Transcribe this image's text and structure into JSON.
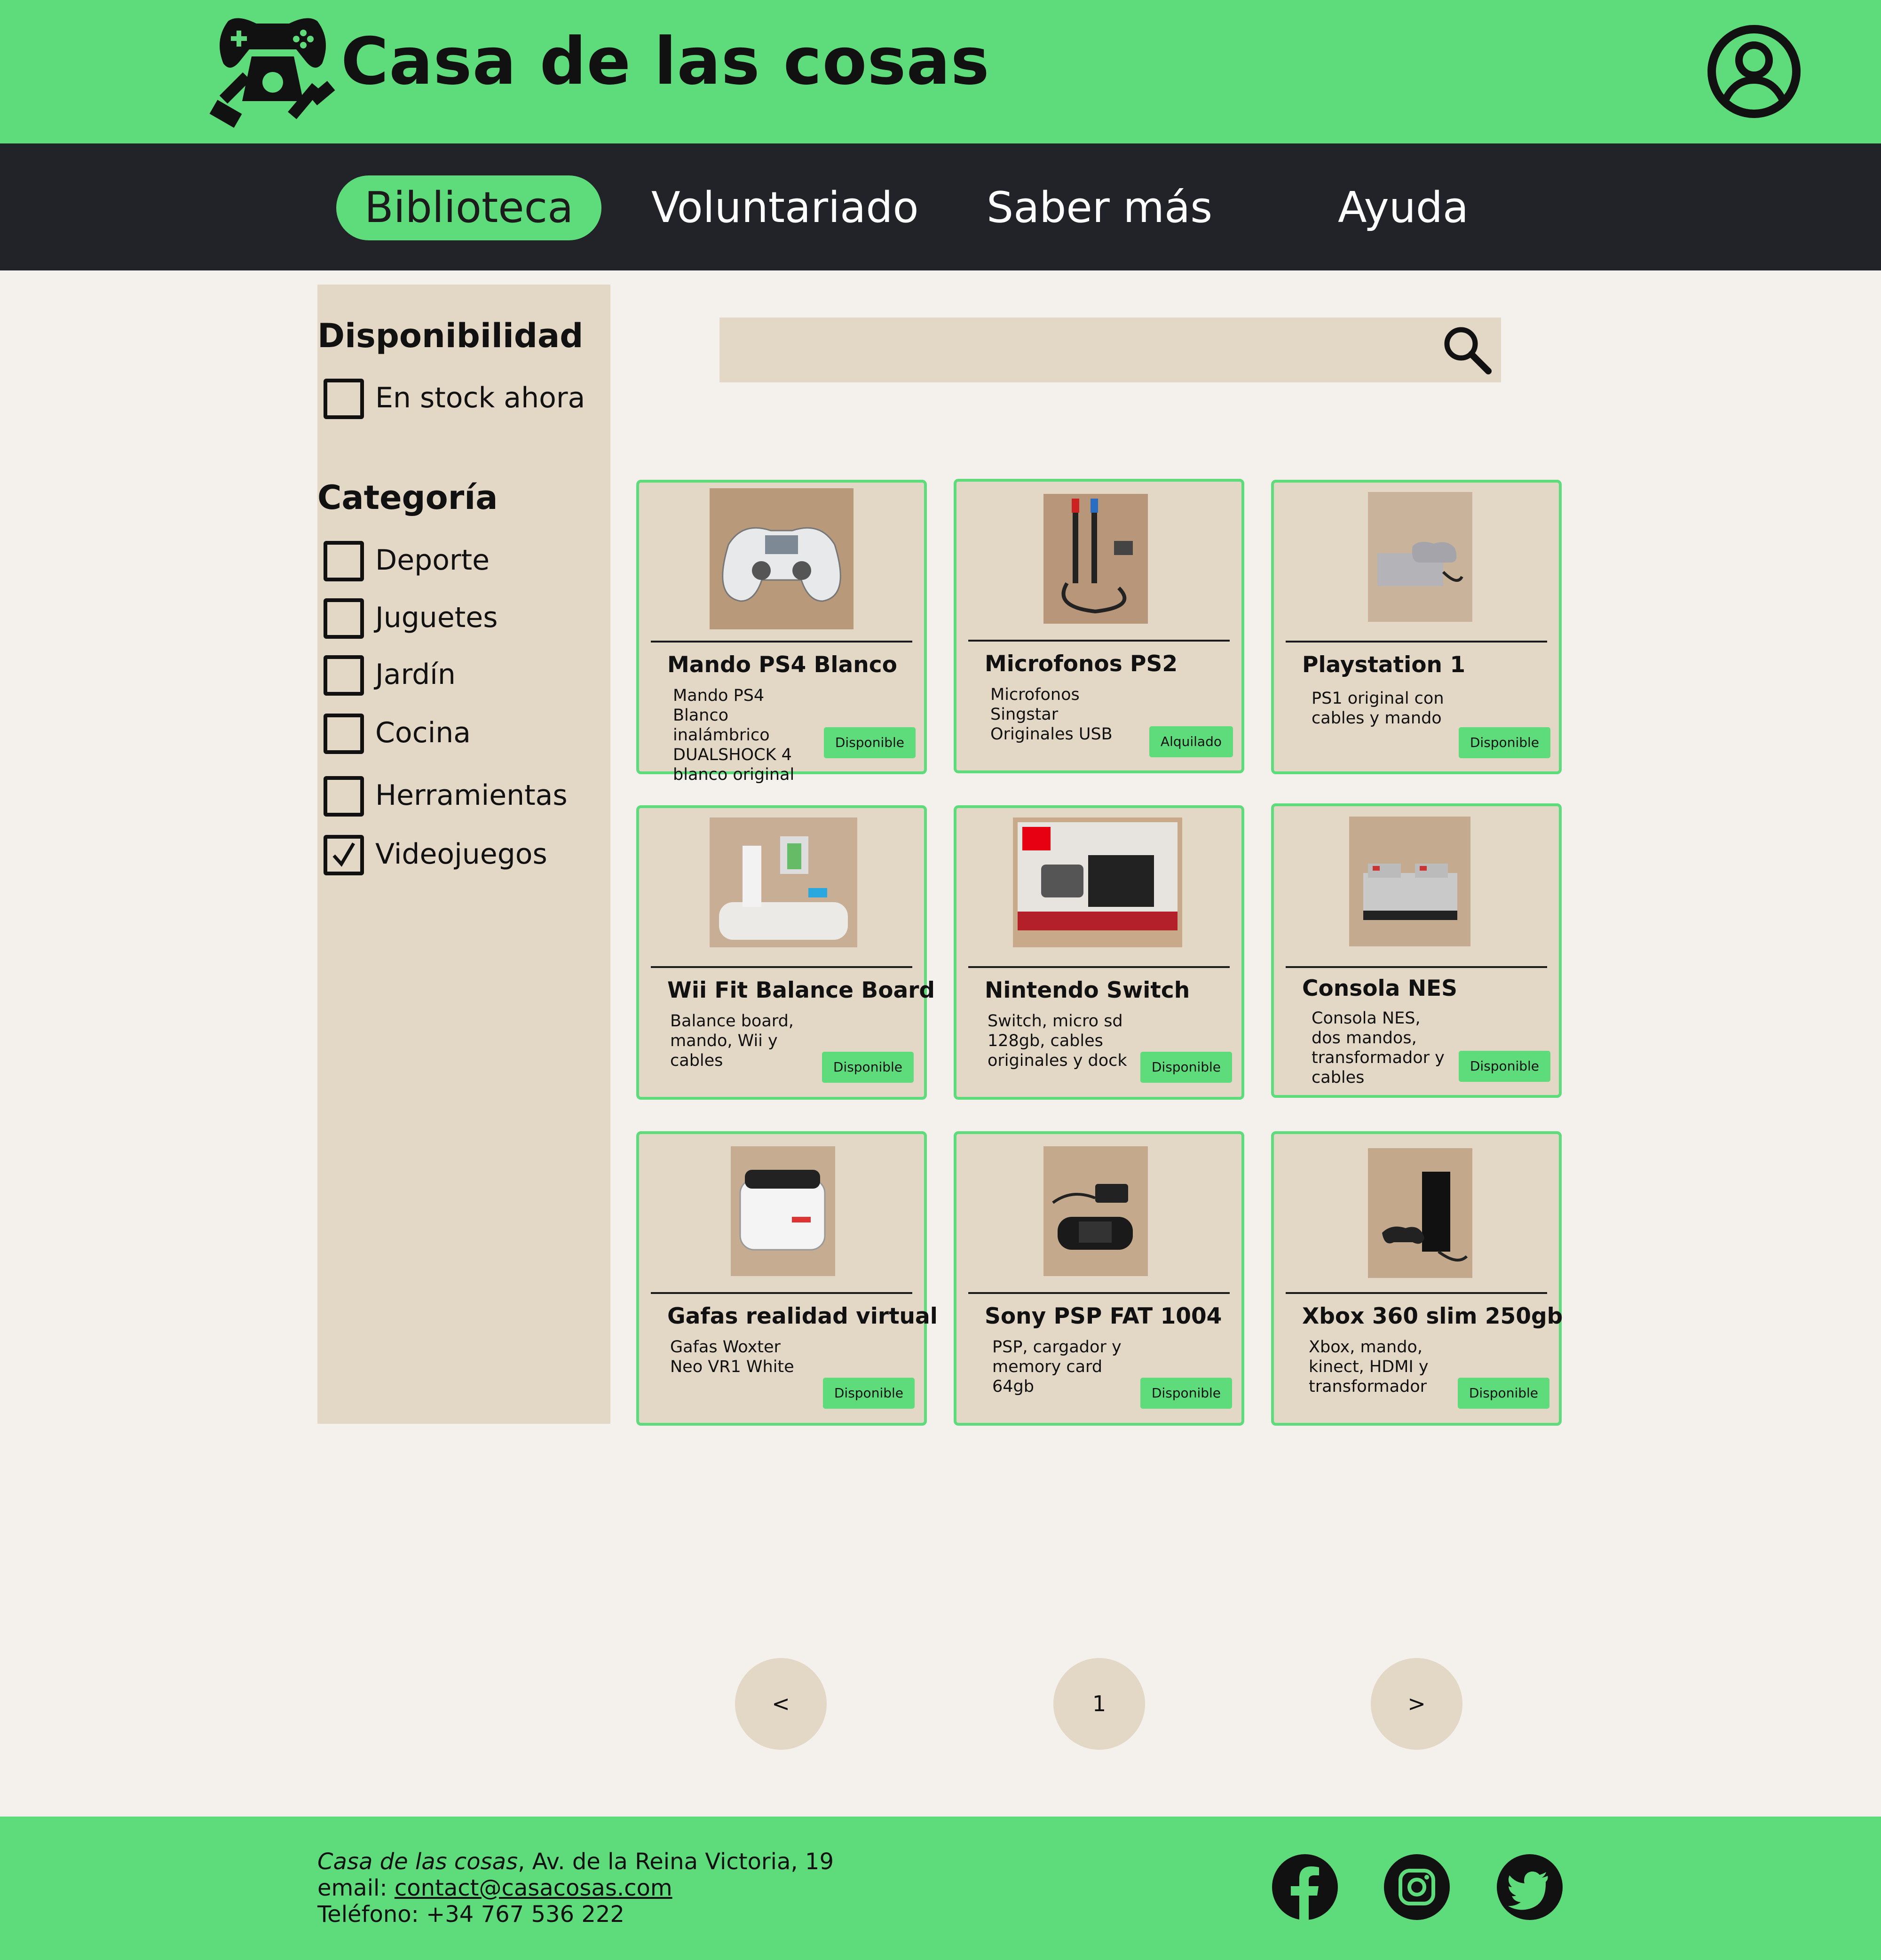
{
  "header": {
    "title": "Casa de las cosas",
    "logo_icon": "gamepad-tools-logo-icon",
    "user_icon": "user-account-icon"
  },
  "nav": {
    "items": [
      {
        "label": "Biblioteca",
        "active": true
      },
      {
        "label": "Voluntariado",
        "active": false
      },
      {
        "label": "Saber más",
        "active": false
      },
      {
        "label": "Ayuda",
        "active": false
      }
    ]
  },
  "sidebar": {
    "availability": {
      "heading": "Disponibilidad",
      "options": [
        {
          "label": "En stock ahora",
          "checked": false
        }
      ]
    },
    "category": {
      "heading": "Categoría",
      "options": [
        {
          "label": "Deporte",
          "checked": false
        },
        {
          "label": "Juguetes",
          "checked": false
        },
        {
          "label": "Jardín",
          "checked": false
        },
        {
          "label": "Cocina",
          "checked": false
        },
        {
          "label": "Herramientas",
          "checked": false
        },
        {
          "label": "Videojuegos",
          "checked": true
        }
      ]
    }
  },
  "search": {
    "value": "",
    "placeholder": "",
    "icon": "search-icon"
  },
  "products": [
    {
      "title": "Mando PS4 Blanco",
      "description": "Mando PS4 Blanco inalámbrico DUALSHOCK 4 blanco original",
      "status": "Disponible",
      "image": "controller-image"
    },
    {
      "title": "Microfonos PS2",
      "description": "Microfonos Singstar Originales USB",
      "status": "Alquilado",
      "image": "microphones-image"
    },
    {
      "title": "Playstation 1",
      "description": "PS1 original con cables y mando",
      "status": "Disponible",
      "image": "console-image"
    },
    {
      "title": "Wii Fit Balance Board",
      "description": "Balance board, mando, Wii y cables",
      "status": "Disponible",
      "image": "balance-board-image"
    },
    {
      "title": "Nintendo Switch",
      "description": "Switch, micro sd 128gb, cables originales y dock",
      "status": "Disponible",
      "image": "switch-box-image"
    },
    {
      "title": "Consola NES",
      "description": "Consola NES, dos mandos, transformador y cables",
      "status": "Disponible",
      "image": "nes-console-image"
    },
    {
      "title": "Gafas realidad virtual",
      "description": "Gafas Woxter Neo VR1 White",
      "status": "Disponible",
      "image": "vr-headset-image"
    },
    {
      "title": "Sony PSP FAT 1004",
      "description": "PSP, cargador y memory card 64gb",
      "status": "Disponible",
      "image": "psp-image"
    },
    {
      "title": "Xbox 360 slim 250gb",
      "description": "Xbox, mando, kinect, HDMI y transformador",
      "status": "Disponible",
      "image": "xbox-image"
    }
  ],
  "pagination": {
    "prev": "<",
    "current": "1",
    "next": ">"
  },
  "footer": {
    "org_name": "Casa de las cosas",
    "address": ", Av. de la Reina Victoria, 19",
    "email_label": "email: ",
    "email": "contact@casacosas.com",
    "phone": "Teléfono: +34 767 536 222",
    "social": [
      "facebook-icon",
      "instagram-icon",
      "twitter-icon"
    ]
  },
  "colors": {
    "brand_green": "#5edc7c",
    "nav_dark": "#212328",
    "panel_beige": "#e3d7c5",
    "page_bg": "#f4f1ec"
  }
}
